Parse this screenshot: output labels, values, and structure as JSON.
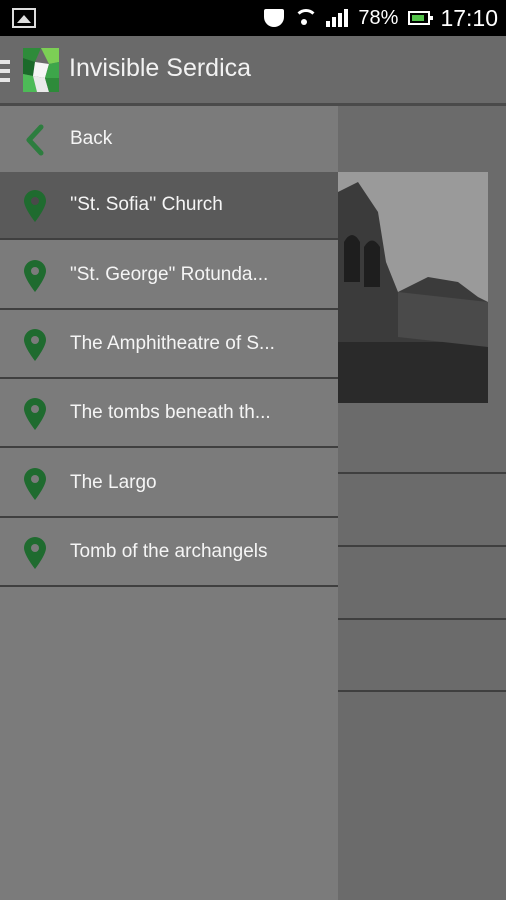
{
  "status_bar": {
    "battery": "78%",
    "time": "17:10"
  },
  "app_bar": {
    "title": "Invisible Serdica"
  },
  "drawer": {
    "back_label": "Back",
    "items": [
      {
        "label": "''St. Sofia'' Church",
        "active": true
      },
      {
        "label": "\"St. George\" Rotunda...",
        "active": false
      },
      {
        "label": "The Amphitheatre of S...",
        "active": false
      },
      {
        "label": "The tombs beneath th...",
        "active": false
      },
      {
        "label": "The Largo",
        "active": false
      },
      {
        "label": "Tomb of the archangels",
        "active": false
      }
    ]
  },
  "colors": {
    "pin": "#1f6b2f",
    "accent": "#2d7d3f"
  }
}
